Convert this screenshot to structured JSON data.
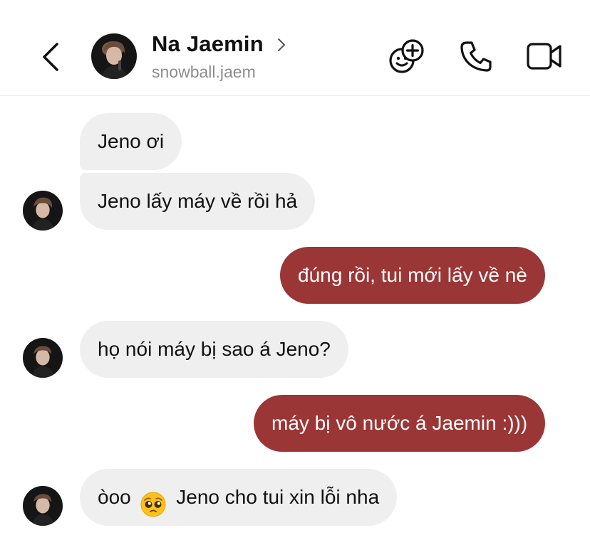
{
  "contact": {
    "name": "Na Jaemin",
    "handle": "snowball.jaem"
  },
  "header": {
    "back_icon": "chevron-left-icon",
    "profile_chevron_icon": "chevron-right-icon",
    "actions": [
      {
        "icon": "sticker-add-icon"
      },
      {
        "icon": "phone-icon"
      },
      {
        "icon": "video-camera-icon"
      }
    ]
  },
  "messages": [
    {
      "sender": "them",
      "text": "Jeno ơi"
    },
    {
      "sender": "them",
      "text": "Jeno lấy máy về rồi hả"
    },
    {
      "sender": "me",
      "text": "đúng rồi, tui mới lấy về nè"
    },
    {
      "sender": "them",
      "text": "họ nói máy bị sao á Jeno?"
    },
    {
      "sender": "me",
      "text": "máy bị vô nước á Jaemin :)))"
    },
    {
      "sender": "them",
      "text_before": "òoo",
      "emoji": "pleading-face-icon",
      "text_after": "Jeno cho tui xin lỗi nha"
    }
  ],
  "colors": {
    "outgoing_bubble": "#9b3636",
    "incoming_bubble": "#efefef",
    "muted_text": "#8e8e8e"
  }
}
